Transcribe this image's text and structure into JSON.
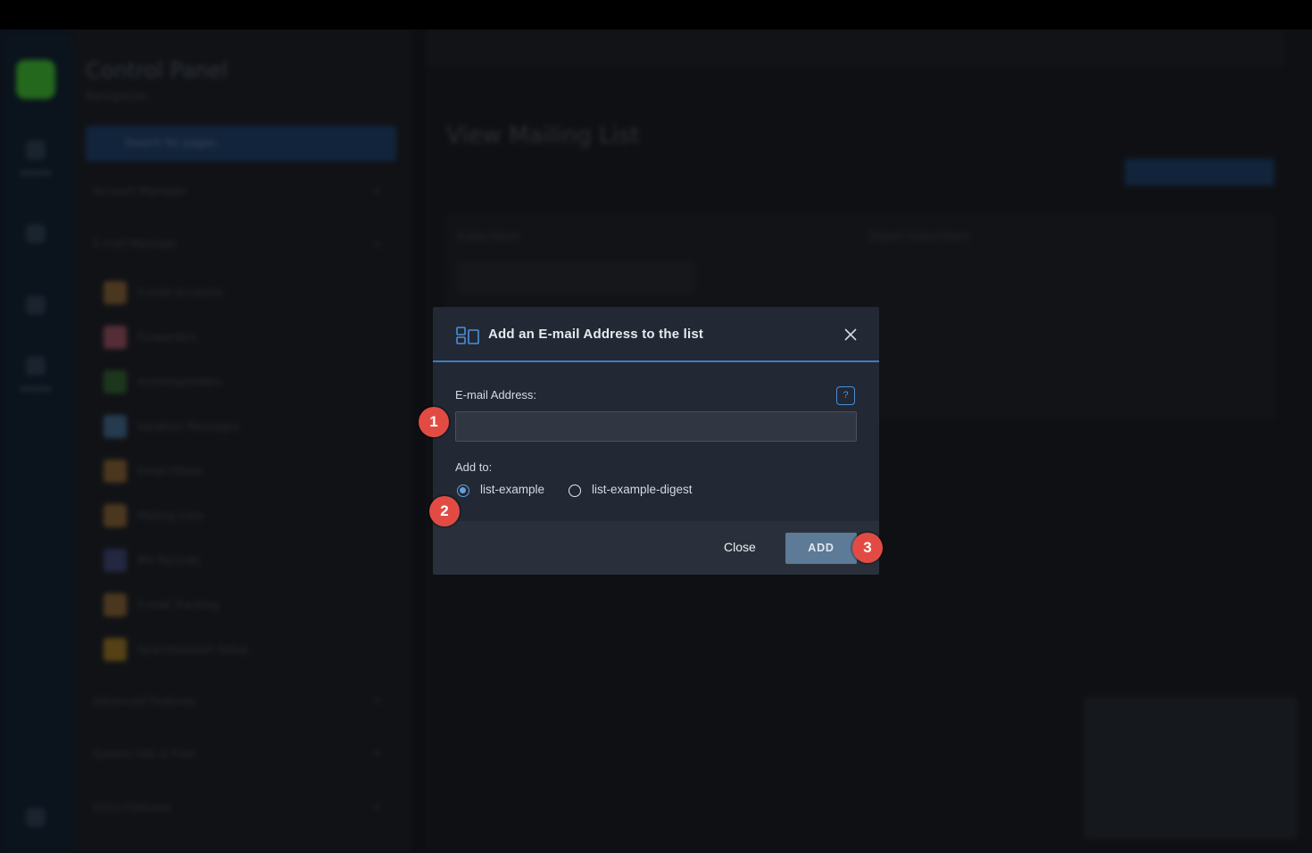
{
  "background": {
    "sidebar_title": "Control Panel",
    "sidebar_subtitle": "Navigation",
    "search_placeholder": "Search for pages",
    "sections": [
      "Account Manager",
      "E-mail Manager",
      "Advanced Features",
      "System Info & Files",
      "Extra Features"
    ],
    "email_items": [
      "E-mail Accounts",
      "Forwarders",
      "Autoresponders",
      "Vacation Messages",
      "Email Filters",
      "Mailing Lists",
      "MX Records",
      "E-mail Tracking",
      "SpamAssassin Setup"
    ],
    "page_title": "View Mailing List",
    "tabs": [
      "Subscribers",
      "Digest Subscribers"
    ]
  },
  "modal": {
    "title": "Add an E-mail Address to the list",
    "email_label": "E-mail Address:",
    "email_value": "",
    "help_icon": "?",
    "add_to_label": "Add to:",
    "options": [
      {
        "label": "list-example",
        "selected": true
      },
      {
        "label": "list-example-digest",
        "selected": false
      }
    ],
    "close_label": "Close",
    "add_label": "ADD"
  },
  "badges": [
    "1",
    "2",
    "3"
  ],
  "colors": {
    "accent": "#3b7ec0",
    "add_button": "#5d7a97",
    "badge": "#e24b43",
    "modal_bg": "#222834"
  }
}
